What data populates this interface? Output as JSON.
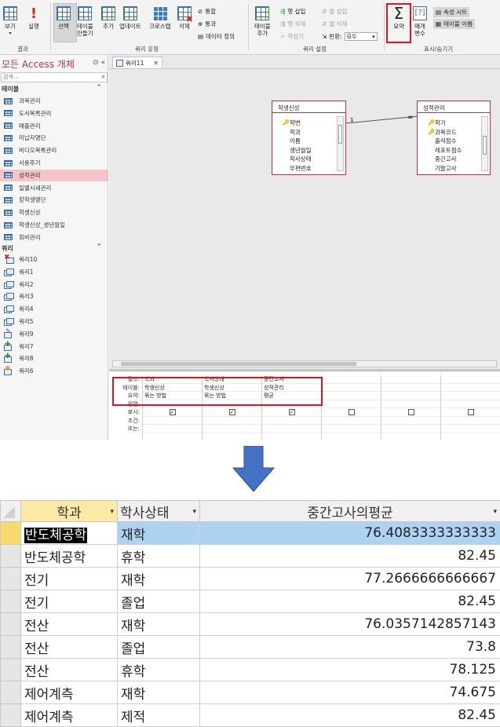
{
  "ribbon": {
    "view_label": "보기",
    "run_label": "실행",
    "select_label": "선택",
    "make_table_label": "테이블\n만들기",
    "append_label": "추가",
    "update_label": "업데이트",
    "crosstab_label": "크로스탭",
    "delete_label": "삭제",
    "union_label": "통합",
    "pass_through_label": "통과",
    "data_def_label": "데이터 정의",
    "add_table_label": "테이블\n추가",
    "insert_row_label": "행 삽입",
    "delete_row_label": "행 삭제",
    "builder_label": "작성기",
    "insert_col_label": "열 삽입",
    "delete_col_label": "열 삭제",
    "return_label": "반환:",
    "return_value": "모두",
    "totals_label": "요약",
    "parameters_label": "매개\n변수",
    "property_sheet_label": "속성 시트",
    "table_names_label": "테이블 이름",
    "group_results": "결과",
    "group_query_type": "쿼리 유형",
    "group_query_setup": "쿼리 설정",
    "group_show_hide": "표시/숨기기"
  },
  "nav": {
    "title": "모든 Access 개체",
    "search_placeholder": "검색...",
    "tables_header": "테이블",
    "tables": [
      "과목관리",
      "도서목록관리",
      "매출관리",
      "미납자명단",
      "비디오목록관리",
      "사용후기",
      "성적관리",
      "일별시세관리",
      "장학생명단",
      "학생신상",
      "학생신상_생년월일",
      "회비관리"
    ],
    "queries_header": "쿼리",
    "queries": [
      "쿼리10",
      "쿼리1",
      "쿼리2",
      "쿼리3",
      "쿼리4",
      "쿼리5",
      "쿼리9",
      "쿼리7",
      "쿼리8",
      "쿼리6"
    ]
  },
  "design": {
    "tab_label": "쿼리11",
    "table_left": {
      "name": "학생신상",
      "fields": [
        "학번",
        "학과",
        "이름",
        "생년월일",
        "학사상태",
        "우편번호"
      ]
    },
    "table_right": {
      "name": "성적관리",
      "fields": [
        "학기",
        "과목코드",
        "출석점수",
        "레포트점수",
        "중간고사",
        "기말고사"
      ]
    },
    "join_one": "1",
    "join_many": "∞",
    "grid_labels": [
      "필드:",
      "테이블:",
      "요약:",
      "정렬:",
      "표시:",
      "조건:",
      "또는:"
    ],
    "grid_columns": [
      {
        "field": "학과",
        "table": "학생신상",
        "total": "묶는 방법"
      },
      {
        "field": "학사상태",
        "table": "학생신상",
        "total": "묶는 방법"
      },
      {
        "field": "중간고사",
        "table": "성적관리",
        "total": "평균"
      }
    ]
  },
  "result": {
    "headers": [
      "학과",
      "학사상태",
      "중간고사의평균"
    ],
    "rows": [
      {
        "dept": "반도체공학",
        "status": "재학",
        "avg": "76.4083333333333"
      },
      {
        "dept": "반도체공학",
        "status": "휴학",
        "avg": "82.45"
      },
      {
        "dept": "전기",
        "status": "재학",
        "avg": "77.2666666666667"
      },
      {
        "dept": "전기",
        "status": "졸업",
        "avg": "82.45"
      },
      {
        "dept": "전산",
        "status": "재학",
        "avg": "76.0357142857143"
      },
      {
        "dept": "전산",
        "status": "졸업",
        "avg": "73.8"
      },
      {
        "dept": "전산",
        "status": "휴학",
        "avg": "78.125"
      },
      {
        "dept": "제어계측",
        "status": "재학",
        "avg": "74.675"
      },
      {
        "dept": "제어계측",
        "status": "제적",
        "avg": "82.45"
      }
    ]
  },
  "colors": {
    "highlight_red": "#e0141e",
    "nav_title": "#b4324f",
    "selected_row": "#aed2f2",
    "arrow": "#4472c4"
  }
}
